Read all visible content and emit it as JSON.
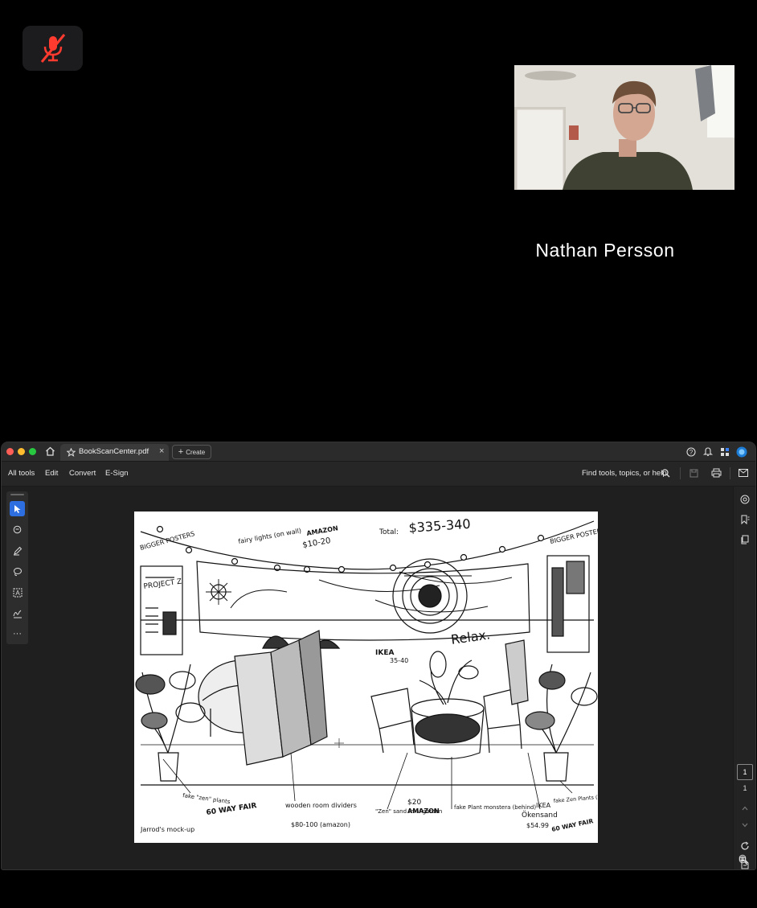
{
  "call": {
    "participant_name": "Nathan Persson",
    "mute_icon": "mic-off-icon",
    "mute_color": "#ff3b30"
  },
  "app": {
    "tab_title": "BookScanCenter.pdf",
    "create_label": "Create",
    "menu": {
      "all_tools": "All tools",
      "edit": "Edit",
      "convert": "Convert",
      "esign": "E-Sign"
    },
    "search_label": "Find tools, topics, or help",
    "page_current": "1",
    "page_total": "1",
    "accent_color": "#2d6fe0"
  },
  "sketch": {
    "total": "Total:",
    "total_value": "$335-340",
    "bigger_posters_left": "BIGGER POSTERS",
    "bigger_posters_right": "BIGGER POSTERS",
    "fairy_lights": "fairy lights (on wall)",
    "fairy_amazon": "AMAZON",
    "fairy_price": "$10-20",
    "project_z": "PROJECT Z",
    "relax": "Relax.",
    "ikea_top": "IKEA",
    "ikea_top_price": "35-40",
    "fake_zen_left": "fake \"zen\" plants",
    "wayfair_left": "60 WAY FAIR",
    "divider": "wooden room dividers",
    "divider_price": "$80-100 (amazon)",
    "zen_garden": "\"Zen\" sand mini garden",
    "zen_price": "$20",
    "zen_amazon": "AMAZON",
    "monstera": "fake Plant monstera (behind)",
    "ikea_bottom": "IKEA",
    "ikea_product": "Ökensand",
    "ikea_price": "$54.99",
    "fake_zen_right": "fake Zen Plants (??)",
    "wayfair_right": "60 WAY FAIR",
    "mockup": "Jarrod's mock-up"
  }
}
